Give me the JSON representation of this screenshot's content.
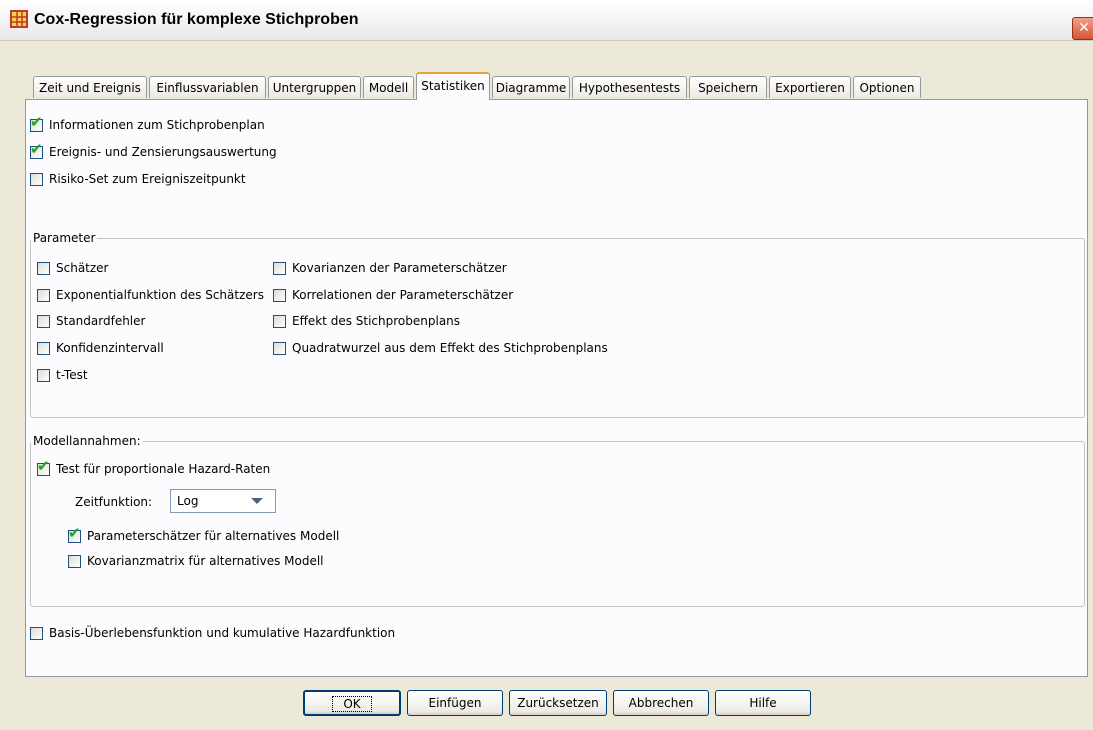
{
  "window": {
    "title": "Cox-Regression für komplexe Stichproben",
    "close_glyph": "✕"
  },
  "tabs": [
    {
      "label": "Zeit und Ereignis",
      "active": false
    },
    {
      "label": "Einflussvariablen",
      "active": false
    },
    {
      "label": "Untergruppen",
      "active": false
    },
    {
      "label": "Modell",
      "active": false
    },
    {
      "label": "Statistiken",
      "active": true
    },
    {
      "label": "Diagramme",
      "active": false
    },
    {
      "label": "Hypothesentests",
      "active": false
    },
    {
      "label": "Speichern",
      "active": false
    },
    {
      "label": "Exportieren",
      "active": false
    },
    {
      "label": "Optionen",
      "active": false
    }
  ],
  "top_options": [
    {
      "label": "Informationen zum Stichprobenplan",
      "checked": true
    },
    {
      "label": "Ereignis- und Zensierungsauswertung",
      "checked": true
    },
    {
      "label": "Risiko-Set zum Ereigniszeitpunkt",
      "checked": false
    }
  ],
  "parameter": {
    "legend": "Parameter",
    "left": [
      {
        "label": "Schätzer",
        "checked": false
      },
      {
        "label": "Exponentialfunktion des Schätzers",
        "checked": false
      },
      {
        "label": "Standardfehler",
        "checked": false
      },
      {
        "label": "Konfidenzintervall",
        "checked": false
      },
      {
        "label": "t-Test",
        "checked": false
      }
    ],
    "right": [
      {
        "label": "Kovarianzen der Parameterschätzer",
        "checked": false
      },
      {
        "label": "Korrelationen der Parameterschätzer",
        "checked": false
      },
      {
        "label": "Effekt des Stichprobenplans",
        "checked": false
      },
      {
        "label": "Quadratwurzel aus dem Effekt des Stichprobenplans",
        "checked": false
      }
    ]
  },
  "model": {
    "legend": "Modellannahmen:",
    "test": {
      "label": "Test für proportionale Hazard-Raten",
      "checked": true
    },
    "time_function_label": "Zeitfunktion:",
    "time_function_value": "Log",
    "params_alt": {
      "label": "Parameterschätzer für alternatives Modell",
      "checked": true
    },
    "cov_alt": {
      "label": "Kovarianzmatrix für alternatives Modell",
      "checked": false
    }
  },
  "baseline": {
    "label": "Basis-Überlebensfunktion und kumulative Hazardfunktion",
    "checked": false
  },
  "buttons": {
    "ok": "OK",
    "paste": "Einfügen",
    "reset": "Zurücksetzen",
    "cancel": "Abbrechen",
    "help": "Hilfe"
  },
  "colors": {
    "dialog_bg": "#ece9d8",
    "panel_bg": "#fcfcfe",
    "check_mark": "#21a121",
    "active_tab_accent": "#e8a33f"
  }
}
